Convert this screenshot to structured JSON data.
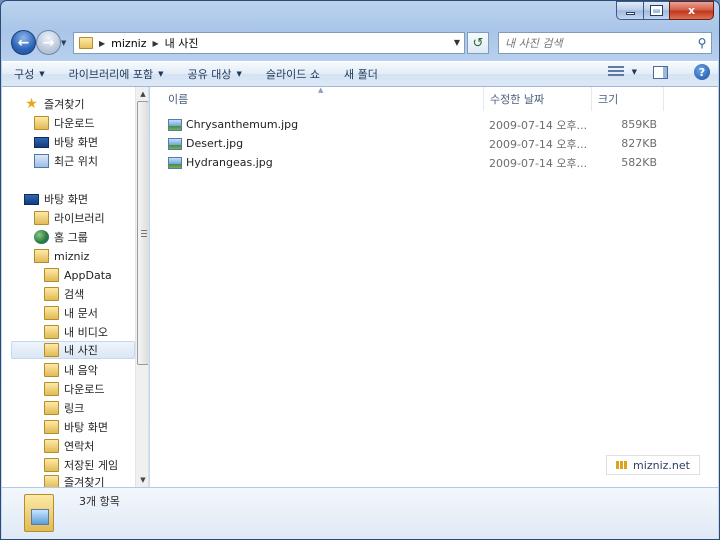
{
  "window": {
    "caption_minimize": "",
    "caption_maximize": "",
    "caption_close": "x"
  },
  "nav": {
    "back_glyph": "←",
    "forward_glyph": "→",
    "breadcrumb": [
      "mizniz",
      "내 사진"
    ],
    "refresh_glyph": "↺",
    "search_placeholder": "내 사진 검색"
  },
  "commands": [
    {
      "label": "구성",
      "has_dropdown": true
    },
    {
      "label": "라이브러리에 포함",
      "has_dropdown": true
    },
    {
      "label": "공유 대상",
      "has_dropdown": true
    },
    {
      "label": "슬라이드 쇼",
      "has_dropdown": false
    },
    {
      "label": "새 폴더",
      "has_dropdown": false
    }
  ],
  "sidebar": {
    "favorites": {
      "label": "즐겨찾기",
      "items": [
        "다운로드",
        "바탕 화면",
        "최근 위치"
      ]
    },
    "desktop": {
      "label": "바탕 화면",
      "items": [
        "라이브러리",
        "홈 그룹",
        "mizniz"
      ]
    },
    "user_folders": [
      "AppData",
      "검색",
      "내 문서",
      "내 비디오",
      "내 사진",
      "내 음악",
      "다운로드",
      "링크",
      "바탕 화면",
      "연락처",
      "저장된 게임",
      "즐겨찾기"
    ],
    "selected": "내 사진"
  },
  "columns": {
    "name": "이름",
    "date": "수정한 날짜",
    "size": "크기"
  },
  "files": [
    {
      "name": "Chrysanthemum.jpg",
      "date": "2009-07-14 오후...",
      "size": "859KB"
    },
    {
      "name": "Desert.jpg",
      "date": "2009-07-14 오후...",
      "size": "827KB"
    },
    {
      "name": "Hydrangeas.jpg",
      "date": "2009-07-14 오후...",
      "size": "582KB"
    }
  ],
  "watermark": "mizniz.net",
  "details": {
    "count_text": "3개 항목"
  },
  "colors": {
    "accent": "#2b5797",
    "window_frame": "#bcd3ef",
    "selection": "#dbe7f6"
  }
}
